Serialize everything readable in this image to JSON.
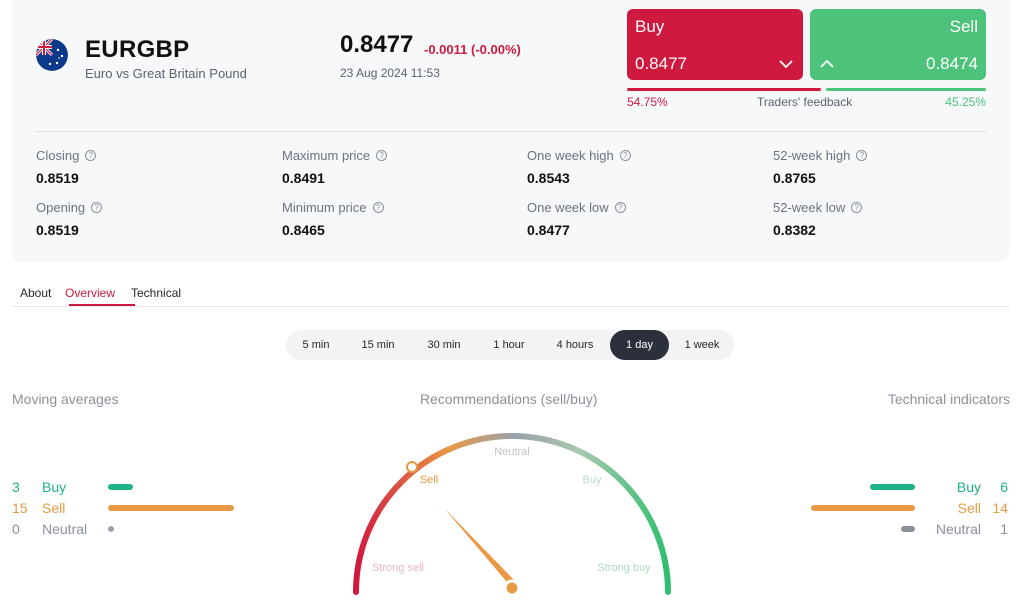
{
  "instrument": {
    "symbol": "EURGBP",
    "name": "Euro vs Great Britain Pound",
    "price": "0.8477",
    "change": "-0.0011 (-0.00%)",
    "timestamp": "23 Aug 2024 11:53"
  },
  "trade": {
    "buy_label": "Buy",
    "buy_price": "0.8477",
    "sell_label": "Sell",
    "sell_price": "0.8474"
  },
  "feedback": {
    "buy_pct": "54.75%",
    "label": "Traders' feedback",
    "sell_pct": "45.25%",
    "buy_fraction": 0.5475
  },
  "stats": [
    {
      "label": "Closing",
      "value": "0.8519"
    },
    {
      "label": "Maximum price",
      "value": "0.8491"
    },
    {
      "label": "One week high",
      "value": "0.8543"
    },
    {
      "label": "52-week high",
      "value": "0.8765"
    },
    {
      "label": "Opening",
      "value": "0.8519"
    },
    {
      "label": "Minimum price",
      "value": "0.8465"
    },
    {
      "label": "One week low",
      "value": "0.8477"
    },
    {
      "label": "52-week low",
      "value": "0.8382"
    }
  ],
  "tabs": [
    {
      "label": "About"
    },
    {
      "label": "Overview",
      "active": true
    },
    {
      "label": "Technical"
    }
  ],
  "periods": [
    {
      "label": "5 min"
    },
    {
      "label": "15 min"
    },
    {
      "label": "30 min"
    },
    {
      "label": "1 hour"
    },
    {
      "label": "4 hours"
    },
    {
      "label": "1 day",
      "active": true
    },
    {
      "label": "1 week"
    }
  ],
  "moving_averages": {
    "title": "Moving averages",
    "rows": [
      {
        "count": "3",
        "label": "Buy",
        "color": "#1fb28a",
        "n": 3
      },
      {
        "count": "15",
        "label": "Sell",
        "color": "#e99a45",
        "n": 15
      },
      {
        "count": "0",
        "label": "Neutral",
        "color": "#8a919c",
        "n": 0
      }
    ]
  },
  "recommendations": {
    "title": "Recommendations (sell/buy)",
    "labels": {
      "strong_sell": "Strong sell",
      "sell": "Sell",
      "neutral": "Neutral",
      "buy": "Buy",
      "strong_buy": "Strong buy"
    },
    "current": "Sell"
  },
  "technical_indicators": {
    "title": "Technical indicators",
    "rows": [
      {
        "count": "6",
        "label": "Buy",
        "color": "#1fb28a",
        "n": 6
      },
      {
        "count": "14",
        "label": "Sell",
        "color": "#e99a45",
        "n": 14
      },
      {
        "count": "1",
        "label": "Neutral",
        "color": "#8a919c",
        "n": 1
      }
    ]
  },
  "colors": {
    "accent": "#d0193f",
    "buy": "#d0193f",
    "sell": "#4cc27a",
    "gauge_sell": "#e99a45"
  }
}
